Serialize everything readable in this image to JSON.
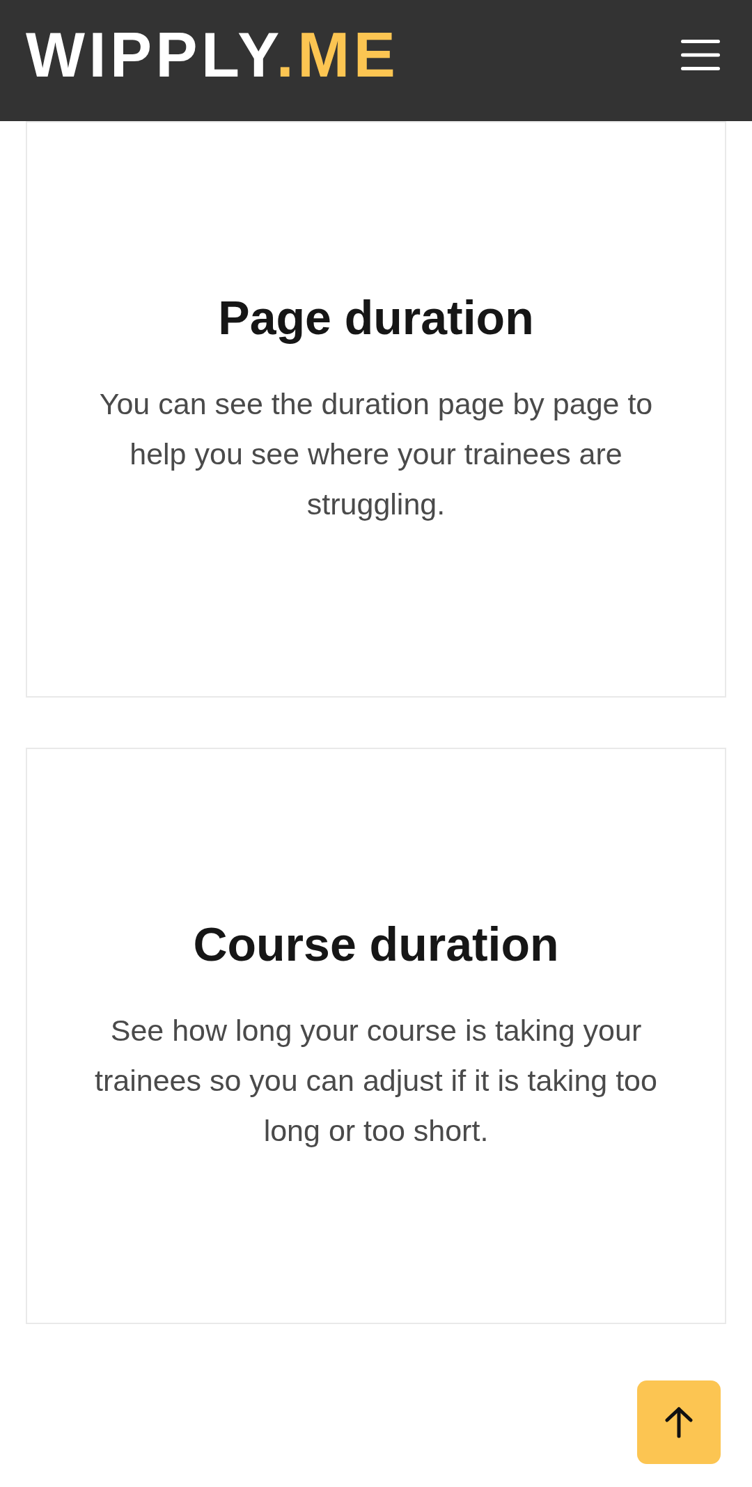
{
  "header": {
    "logo": {
      "name": "WIPPLY",
      "suffix": ".ME"
    }
  },
  "cards": [
    {
      "title": "Page duration",
      "text": "You can see the duration page by page to help you see where your trainees are struggling."
    },
    {
      "title": "Course duration",
      "text": "See how long your course is taking your trainees so you can adjust if it is taking too long or too short."
    }
  ]
}
